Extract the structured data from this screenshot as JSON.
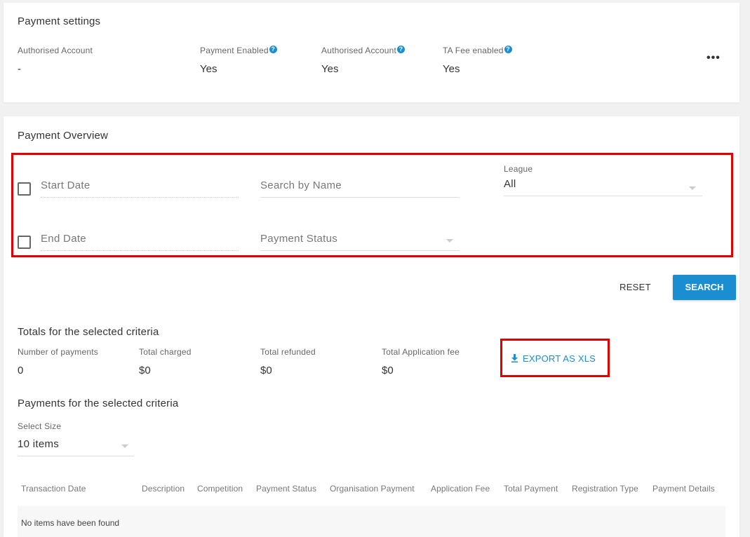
{
  "settings": {
    "title": "Payment settings",
    "fields": [
      {
        "label": "Authorised Account",
        "value": "-"
      },
      {
        "label": "Payment Enabled",
        "value": "Yes"
      },
      {
        "label": "Authorised Account",
        "value": "Yes"
      },
      {
        "label": "TA Fee enabled",
        "value": "Yes"
      }
    ],
    "more_icon": "•••",
    "help_icon": "?"
  },
  "overview": {
    "title": "Payment Overview",
    "filters": {
      "start_date_placeholder": "Start Date",
      "end_date_placeholder": "End Date",
      "search_name_placeholder": "Search by Name",
      "payment_status_placeholder": "Payment Status",
      "league_label": "League",
      "league_value": "All"
    },
    "reset_label": "RESET",
    "search_label": "SEARCH"
  },
  "totals": {
    "title": "Totals for the selected criteria",
    "items": [
      {
        "label": "Number of payments",
        "value": "0"
      },
      {
        "label": "Total charged",
        "value": "$0"
      },
      {
        "label": "Total refunded",
        "value": "$0"
      },
      {
        "label": "Total Application fee",
        "value": "$0"
      }
    ],
    "export_label": "EXPORT AS XLS"
  },
  "payments": {
    "title": "Payments for the selected criteria",
    "size_label": "Select Size",
    "size_value": "10 items",
    "columns": [
      "Transaction Date",
      "Description",
      "Competition",
      "Payment Status",
      "Organisation Payment",
      "Application Fee",
      "Total Payment",
      "Registration Type",
      "Payment Details"
    ],
    "empty_message": "No items have been found"
  },
  "colors": {
    "accent": "#1a8ed1",
    "highlight": "#e00000"
  }
}
